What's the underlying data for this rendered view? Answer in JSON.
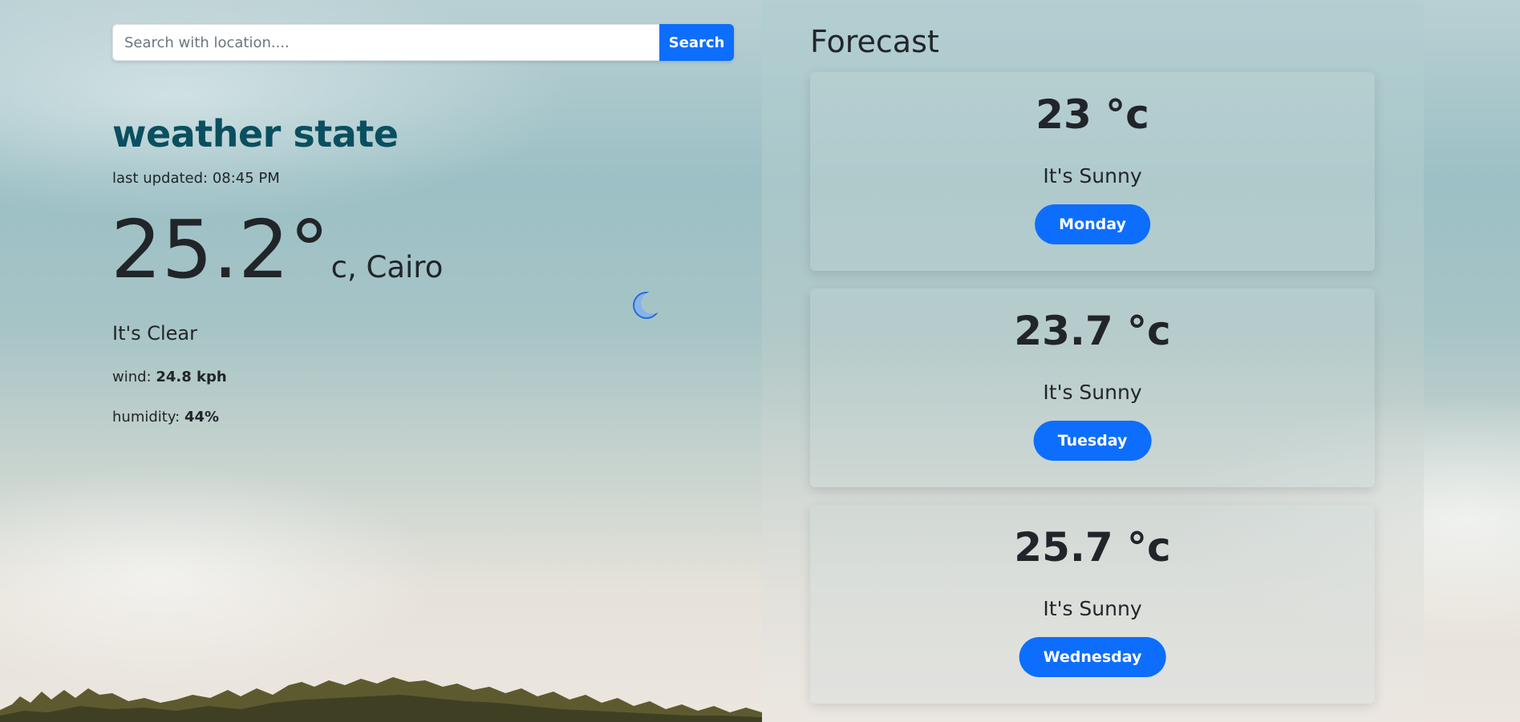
{
  "search": {
    "placeholder": "Search with location....",
    "button_label": "Search"
  },
  "current": {
    "title": "weather state",
    "last_updated": "last updated: 08:45 PM",
    "temperature": "25.2°",
    "unit_location": "c, Cairo",
    "condition": "It's Clear",
    "wind_label": "wind: ",
    "wind_value": "24.8 kph",
    "humidity_label": "humidity: ",
    "humidity_value": "44%",
    "icon": "moon-icon"
  },
  "forecast": {
    "heading": "Forecast",
    "days": [
      {
        "temp": "23 °c",
        "condition": "It's Sunny",
        "day": "Monday"
      },
      {
        "temp": "23.7 °c",
        "condition": "It's Sunny",
        "day": "Tuesday"
      },
      {
        "temp": "25.7 °c",
        "condition": "It's Sunny",
        "day": "Wednesday"
      }
    ]
  },
  "colors": {
    "accent": "#0d6efd",
    "title": "#0a4f5f"
  }
}
